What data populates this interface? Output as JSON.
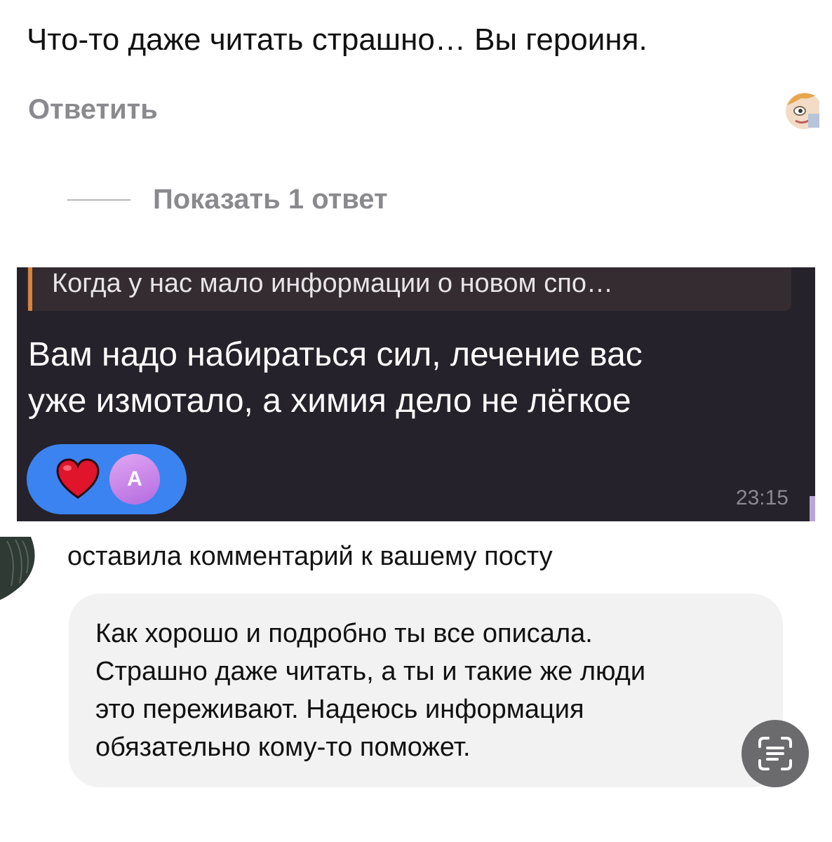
{
  "post_comment": {
    "text": "Что-то даже читать страшно… Вы героиня.",
    "reply_label": "Ответить",
    "show_replies_label": "Показать 1 ответ"
  },
  "chat_message": {
    "quoted_text": "Когда у нас мало информации о новом спо…",
    "line1": "Вам надо набираться сил, лечение вас",
    "line2": "уже измотало, а химия дело не лёгкое",
    "reaction_avatar_letter": "А",
    "time": "23:15",
    "colors": {
      "background": "#25222b",
      "quote_bar": "#d7843c",
      "reaction_pill": "#3b83f1"
    }
  },
  "notification": {
    "action_text": "оставила комментарий к вашему посту",
    "comment_lines": [
      "Как хорошо и подробно ты все описала.",
      "Страшно даже читать, а ты и такие же люди",
      "это переживают. Надеюсь информация",
      "обязательно кому-то поможет."
    ]
  },
  "icons": {
    "reaction": "heart-icon",
    "floating_button": "live-text-scan-icon"
  }
}
